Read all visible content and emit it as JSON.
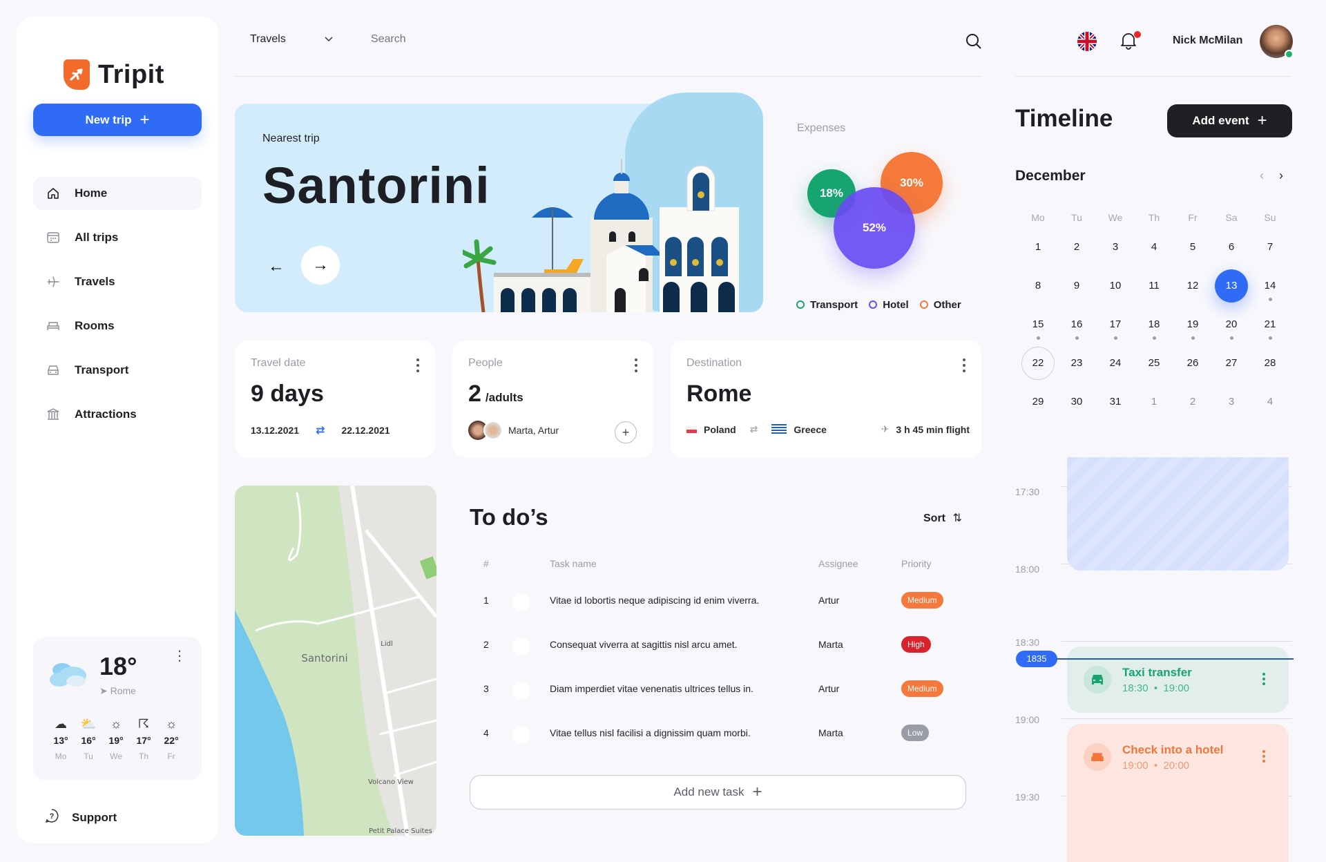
{
  "app": {
    "name": "Tripit",
    "logo_icon": "plane-shield-icon"
  },
  "sidebar": {
    "new_trip_label": "New trip",
    "items": [
      {
        "label": "Home",
        "icon": "home-icon",
        "active": true
      },
      {
        "label": "All trips",
        "icon": "calendar-icon",
        "active": false
      },
      {
        "label": "Travels",
        "icon": "plane-icon",
        "active": false
      },
      {
        "label": "Rooms",
        "icon": "bed-icon",
        "active": false
      },
      {
        "label": "Transport",
        "icon": "car-icon",
        "active": false
      },
      {
        "label": "Attractions",
        "icon": "museum-icon",
        "active": false
      }
    ],
    "weather": {
      "temp": "18°",
      "location": "Rome",
      "forecast": [
        {
          "icon": "cloud-icon",
          "temp": "13°",
          "day": "Mo"
        },
        {
          "icon": "partly-cloudy-icon",
          "temp": "16°",
          "day": "Tu"
        },
        {
          "icon": "sun-icon",
          "temp": "19°",
          "day": "We"
        },
        {
          "icon": "thunderstorm-icon",
          "temp": "17°",
          "day": "Th"
        },
        {
          "icon": "sun-icon",
          "temp": "22°",
          "day": "Fr"
        }
      ]
    },
    "support_label": "Support"
  },
  "header": {
    "dropdown_value": "Travels",
    "search_placeholder": "Search",
    "user_name": "Nick McMilan",
    "language": "English (UK)"
  },
  "hero": {
    "subtitle": "Nearest trip",
    "title": "Santorini"
  },
  "expenses": {
    "title": "Expenses",
    "colors": {
      "transport": "#16a56f",
      "hotel": "#6a4cf5",
      "other": "#f5793a"
    }
  },
  "chart_data": {
    "type": "pie",
    "title": "Expenses",
    "categories": [
      "Transport",
      "Hotel",
      "Other"
    ],
    "values": [
      18,
      52,
      30
    ],
    "unit": "%",
    "legend": "bottom"
  },
  "cards": {
    "travel_date": {
      "label": "Travel date",
      "value": "9 days",
      "from": "13.12.2021",
      "to": "22.12.2021"
    },
    "people": {
      "label": "People",
      "count": "2",
      "unit": "/adults",
      "names": "Marta, Artur"
    },
    "destination": {
      "label": "Destination",
      "value": "Rome",
      "from_country": "Poland",
      "to_country": "Greece",
      "flight": "3 h 45 min flight"
    }
  },
  "map": {
    "labels": {
      "town": "Santorini",
      "poi1": "Lidl",
      "poi2": "Volcano View",
      "poi3": "Petit Palace Suites"
    }
  },
  "todos": {
    "title": "To do’s",
    "sort_label": "Sort",
    "columns": {
      "num": "#",
      "task": "Task name",
      "assignee": "Assignee",
      "priority": "Priority"
    },
    "rows": [
      {
        "n": "1",
        "task": "Vitae id lobortis neque adipiscing id enim viverra.",
        "assignee": "Artur",
        "priority": "Medium"
      },
      {
        "n": "2",
        "task": "Consequat viverra at sagittis nisl arcu amet.",
        "assignee": "Marta",
        "priority": "High"
      },
      {
        "n": "3",
        "task": "Diam imperdiet vitae venenatis ultrices tellus in.",
        "assignee": "Artur",
        "priority": "Medium"
      },
      {
        "n": "4",
        "task": "Vitae tellus nisl facilisi a dignissim quam morbi.",
        "assignee": "Marta",
        "priority": "Low"
      }
    ],
    "priority_colors": {
      "Medium": "#f5793a",
      "High": "#d9222b",
      "Low": "#9a9ca6"
    },
    "add_label": "Add new task"
  },
  "timeline": {
    "title": "Timeline",
    "add_event_label": "Add event",
    "month": "December",
    "weekdays": [
      "Mo",
      "Tu",
      "We",
      "Th",
      "Fr",
      "Sa",
      "Su"
    ],
    "weeks": [
      [
        "1",
        "2",
        "3",
        "4",
        "5",
        "6",
        "7"
      ],
      [
        "8",
        "9",
        "10",
        "11",
        "12",
        "13",
        "14"
      ],
      [
        "15",
        "16",
        "17",
        "18",
        "19",
        "20",
        "21"
      ],
      [
        "22",
        "23",
        "24",
        "25",
        "26",
        "27",
        "28"
      ],
      [
        "29",
        "30",
        "31",
        "1",
        "2",
        "3",
        "4"
      ]
    ],
    "selected_day": "13",
    "today_day": "22",
    "times": [
      "17:30",
      "18:00",
      "18:30",
      "19:00",
      "19:30"
    ],
    "current_time": "1835",
    "events": [
      {
        "name": "Taxi transfer",
        "start": "18:30",
        "end": "19:00",
        "icon": "car-icon",
        "color": "#16a56f"
      },
      {
        "name": "Check into a hotel",
        "start": "19:00",
        "end": "20:00",
        "icon": "bed-icon",
        "color": "#f0763d"
      }
    ]
  }
}
